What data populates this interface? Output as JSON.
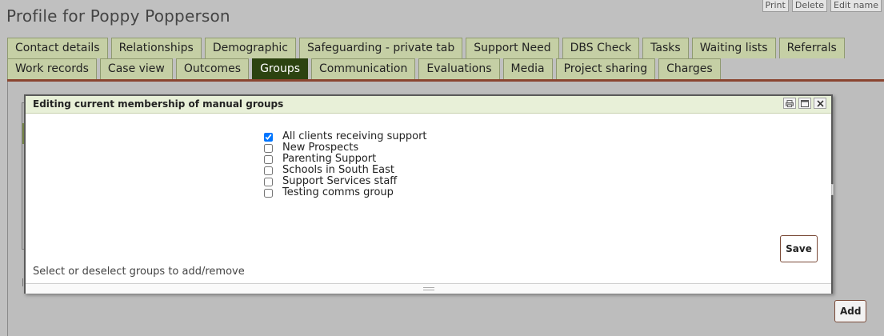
{
  "page": {
    "title": "Profile for Poppy Popperson"
  },
  "top_actions": [
    "Print",
    "Delete",
    "Edit name"
  ],
  "tabs_row1": [
    {
      "label": "Contact details"
    },
    {
      "label": "Relationships"
    },
    {
      "label": "Demographic"
    },
    {
      "label": "Safeguarding - private tab"
    },
    {
      "label": "Support Need"
    },
    {
      "label": "DBS Check"
    },
    {
      "label": "Tasks"
    },
    {
      "label": "Waiting lists"
    },
    {
      "label": "Referrals"
    }
  ],
  "tabs_row2": [
    {
      "label": "Work records"
    },
    {
      "label": "Case view"
    },
    {
      "label": "Outcomes"
    },
    {
      "label": "Groups",
      "active": true
    },
    {
      "label": "Communication"
    },
    {
      "label": "Evaluations"
    },
    {
      "label": "Media"
    },
    {
      "label": "Project sharing"
    },
    {
      "label": "Charges"
    }
  ],
  "modal": {
    "title": "Editing current membership of manual groups",
    "icons": [
      "print-icon",
      "maximize-icon",
      "close-icon"
    ],
    "groups": [
      {
        "label": "All clients receiving support",
        "checked": true
      },
      {
        "label": "New Prospects",
        "checked": false
      },
      {
        "label": "Parenting Support",
        "checked": false
      },
      {
        "label": "Schools in South East",
        "checked": false
      },
      {
        "label": "Support Services staff",
        "checked": false
      },
      {
        "label": "Testing comms group",
        "checked": false
      }
    ],
    "save_label": "Save",
    "hint": "Select or deselect groups to add/remove"
  },
  "add_label": "Add",
  "colors": {
    "background": "#c0c0c0",
    "tab": "#c5cfa5",
    "tab_active": "#2c4310",
    "tab_underline": "#8a4530",
    "modal_header": "#e8f0d8"
  }
}
